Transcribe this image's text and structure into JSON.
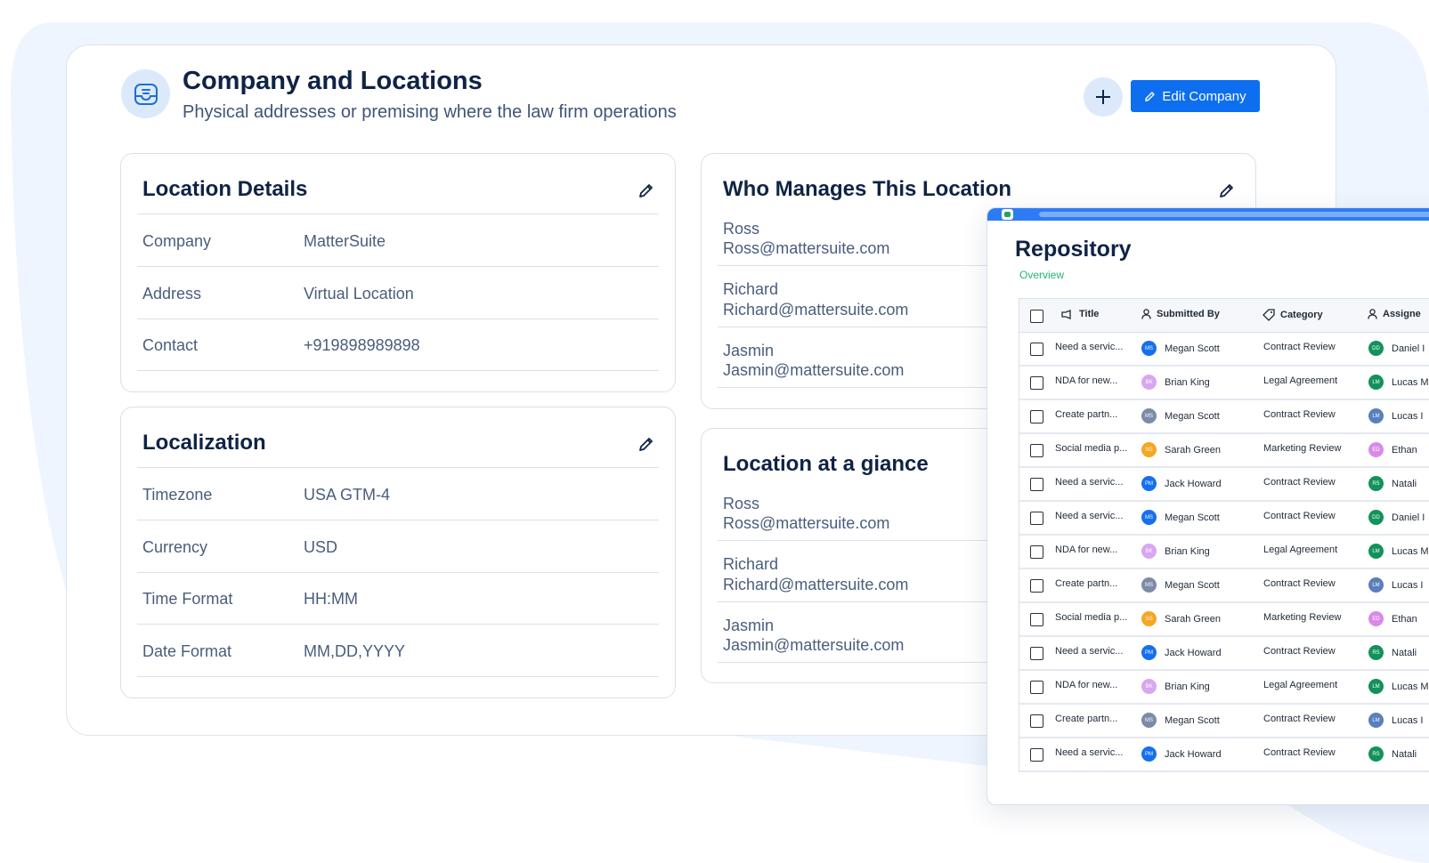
{
  "page": {
    "title": "Company and Locations",
    "subtitle": "Physical addresses or premising where the law firm operations",
    "edit_company_label": "Edit Company",
    "add_icon": "plus-icon",
    "header_icon": "inbox-tray-icon"
  },
  "colors": {
    "accent": "#0d6ff0",
    "accent_soft": "#dbe9fb",
    "heading": "#0f2345",
    "body_text": "#4a5d7c",
    "overview_green": "#22b573"
  },
  "location_details": {
    "title": "Location Details",
    "rows": [
      {
        "label": "Company",
        "value": "MatterSuite"
      },
      {
        "label": "Address",
        "value": "Virtual Location"
      },
      {
        "label": "Contact",
        "value": "+919898989898"
      }
    ]
  },
  "localization": {
    "title": "Localization",
    "rows": [
      {
        "label": "Timezone",
        "value": "USA GTM-4"
      },
      {
        "label": "Currency",
        "value": "USD"
      },
      {
        "label": "Time Format",
        "value": "HH:MM"
      },
      {
        "label": "Date Format",
        "value": "MM,DD,YYYY"
      }
    ]
  },
  "managers": {
    "title": "Who Manages This Location",
    "people": [
      {
        "name": "Ross",
        "email": "Ross@mattersuite.com"
      },
      {
        "name": "Richard",
        "email": "Richard@mattersuite.com"
      },
      {
        "name": "Jasmin",
        "email": "Jasmin@mattersuite.com"
      }
    ]
  },
  "glance": {
    "title": "Location at a giance",
    "people": [
      {
        "name": "Ross",
        "email": "Ross@mattersuite.com"
      },
      {
        "name": "Richard",
        "email": "Richard@mattersuite.com"
      },
      {
        "name": "Jasmin",
        "email": "Jasmin@mattersuite.com"
      }
    ]
  },
  "repository": {
    "title": "Repository",
    "tab": "Overview",
    "columns": [
      "Title",
      "Submitted By",
      "Category",
      "Assigne"
    ],
    "rows": [
      {
        "title": "Need a servic...",
        "submitter": "Megan Scott",
        "sub_initials": "MS",
        "sub_color": "#1570ef",
        "category": "Contract Review",
        "assignee": "Daniel I",
        "asg_initials": "DD",
        "asg_color": "#12925a"
      },
      {
        "title": "NDA for new...",
        "submitter": "Brian King",
        "sub_initials": "BK",
        "sub_color": "#d9a6f0",
        "category": "Legal Agreement",
        "assignee": "Lucas M",
        "asg_initials": "LM",
        "asg_color": "#12925a"
      },
      {
        "title": "Create partn...",
        "submitter": "Megan Scott",
        "sub_initials": "MS",
        "sub_color": "#7d8aa8",
        "category": "Contract Review",
        "assignee": "Lucas I",
        "asg_initials": "LM",
        "asg_color": "#5a7fbd"
      },
      {
        "title": "Social media p...",
        "submitter": "Sarah Green",
        "sub_initials": "SG",
        "sub_color": "#f5a623",
        "category": "Marketing Review",
        "assignee": "Ethan",
        "asg_initials": "ED",
        "asg_color": "#d98ae8"
      },
      {
        "title": "Need a servic...",
        "submitter": "Jack Howard",
        "sub_initials": "PM",
        "sub_color": "#1570ef",
        "category": "Contract Review",
        "assignee": "Natali",
        "asg_initials": "RS",
        "asg_color": "#12925a"
      },
      {
        "title": "Need a servic...",
        "submitter": "Megan Scott",
        "sub_initials": "MS",
        "sub_color": "#1570ef",
        "category": "Contract Review",
        "assignee": "Daniel I",
        "asg_initials": "DD",
        "asg_color": "#12925a"
      },
      {
        "title": "NDA for new...",
        "submitter": "Brian King",
        "sub_initials": "BK",
        "sub_color": "#d9a6f0",
        "category": "Legal Agreement",
        "assignee": "Lucas M",
        "asg_initials": "LM",
        "asg_color": "#12925a"
      },
      {
        "title": "Create partn...",
        "submitter": "Megan Scott",
        "sub_initials": "MS",
        "sub_color": "#7d8aa8",
        "category": "Contract Review",
        "assignee": "Lucas I",
        "asg_initials": "LM",
        "asg_color": "#5a7fbd"
      },
      {
        "title": "Social media p...",
        "submitter": "Sarah Green",
        "sub_initials": "SG",
        "sub_color": "#f5a623",
        "category": "Marketing Review",
        "assignee": "Ethan",
        "asg_initials": "ED",
        "asg_color": "#d98ae8"
      },
      {
        "title": "Need a servic...",
        "submitter": "Jack Howard",
        "sub_initials": "PM",
        "sub_color": "#1570ef",
        "category": "Contract Review",
        "assignee": "Natali",
        "asg_initials": "RS",
        "asg_color": "#12925a"
      },
      {
        "title": "NDA for new...",
        "submitter": "Brian King",
        "sub_initials": "BK",
        "sub_color": "#d9a6f0",
        "category": "Legal Agreement",
        "assignee": "Lucas M",
        "asg_initials": "LM",
        "asg_color": "#12925a"
      },
      {
        "title": "Create partn...",
        "submitter": "Megan Scott",
        "sub_initials": "MS",
        "sub_color": "#7d8aa8",
        "category": "Contract Review",
        "assignee": "Lucas I",
        "asg_initials": "LM",
        "asg_color": "#5a7fbd"
      },
      {
        "title": "Need a servic...",
        "submitter": "Jack Howard",
        "sub_initials": "PM",
        "sub_color": "#1570ef",
        "category": "Contract Review",
        "assignee": "Natali",
        "asg_initials": "RS",
        "asg_color": "#12925a"
      }
    ]
  }
}
